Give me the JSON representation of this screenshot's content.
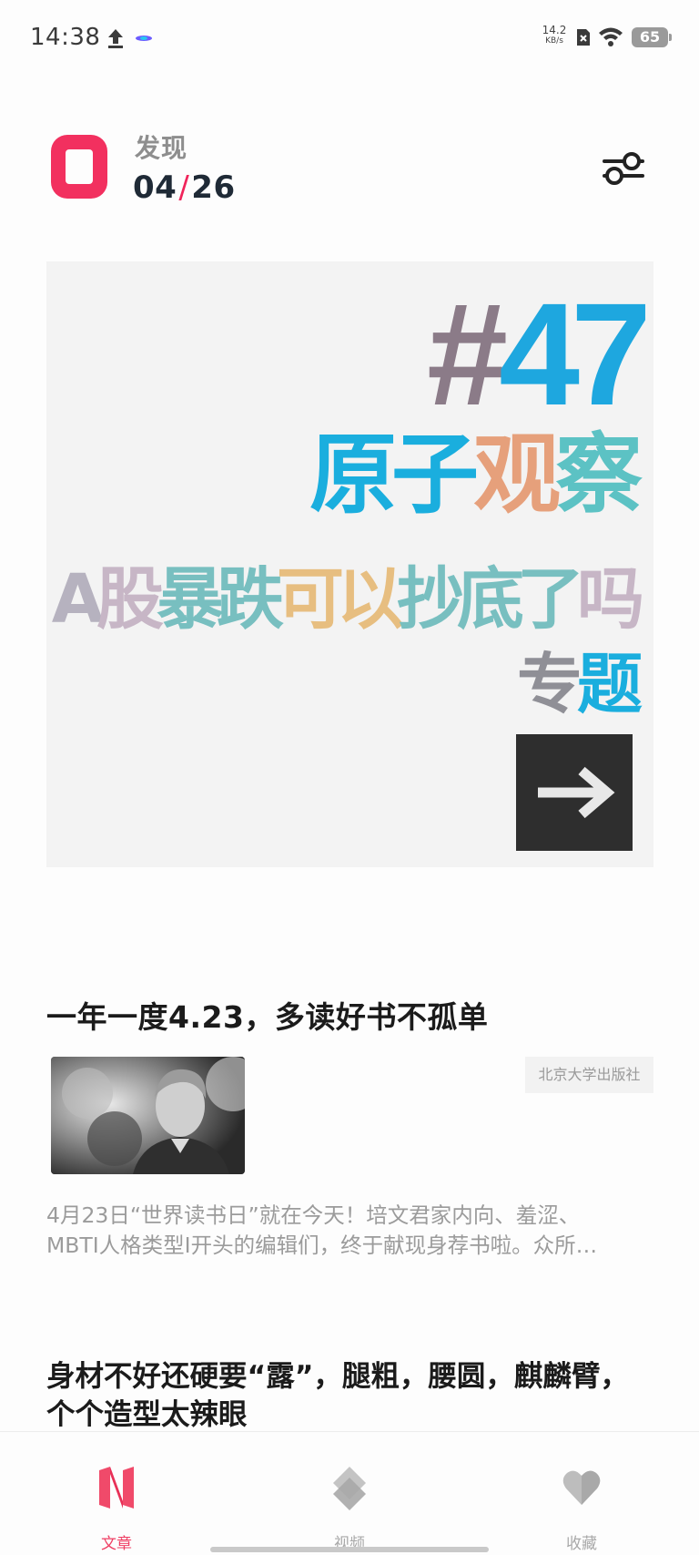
{
  "status_bar": {
    "time": "14:38",
    "net_speed_value": "14.2",
    "net_speed_unit": "KB/s",
    "battery": "65"
  },
  "header": {
    "title": "发现",
    "date_month": "04",
    "date_day": "26"
  },
  "banner": {
    "hash": "#",
    "number": "47",
    "line2": [
      "原子",
      "观",
      "察"
    ],
    "line3": [
      "A",
      "股",
      "暴跌",
      "可以",
      "抄底了",
      "吗"
    ],
    "line4": [
      "专",
      "题"
    ]
  },
  "articles": [
    {
      "title": "一年一度4.23，多读好书不孤单",
      "source": "北京大学出版社",
      "excerpt_line1": "4月23日“世界读书日”就在今天！培文君家内向、羞涩、",
      "excerpt_line2": "MBTI人格类型I开头的编辑们，终于献现身荐书啦。众所…"
    },
    {
      "title": "身材不好还硬要“露”，腿粗，腰圆，麒麟臂，个个造型太辣眼"
    }
  ],
  "bottom_nav": {
    "items": [
      {
        "label": "文章",
        "icon": "article-n-icon",
        "active": true
      },
      {
        "label": "视频",
        "icon": "video-icon",
        "active": false
      },
      {
        "label": "收藏",
        "icon": "heart-icon",
        "active": false
      }
    ]
  },
  "colors": {
    "accent": "#ef3e63",
    "banner_blue": "#1aaede",
    "banner_orange": "#e6a07b",
    "banner_teal": "#5cc2c4"
  }
}
